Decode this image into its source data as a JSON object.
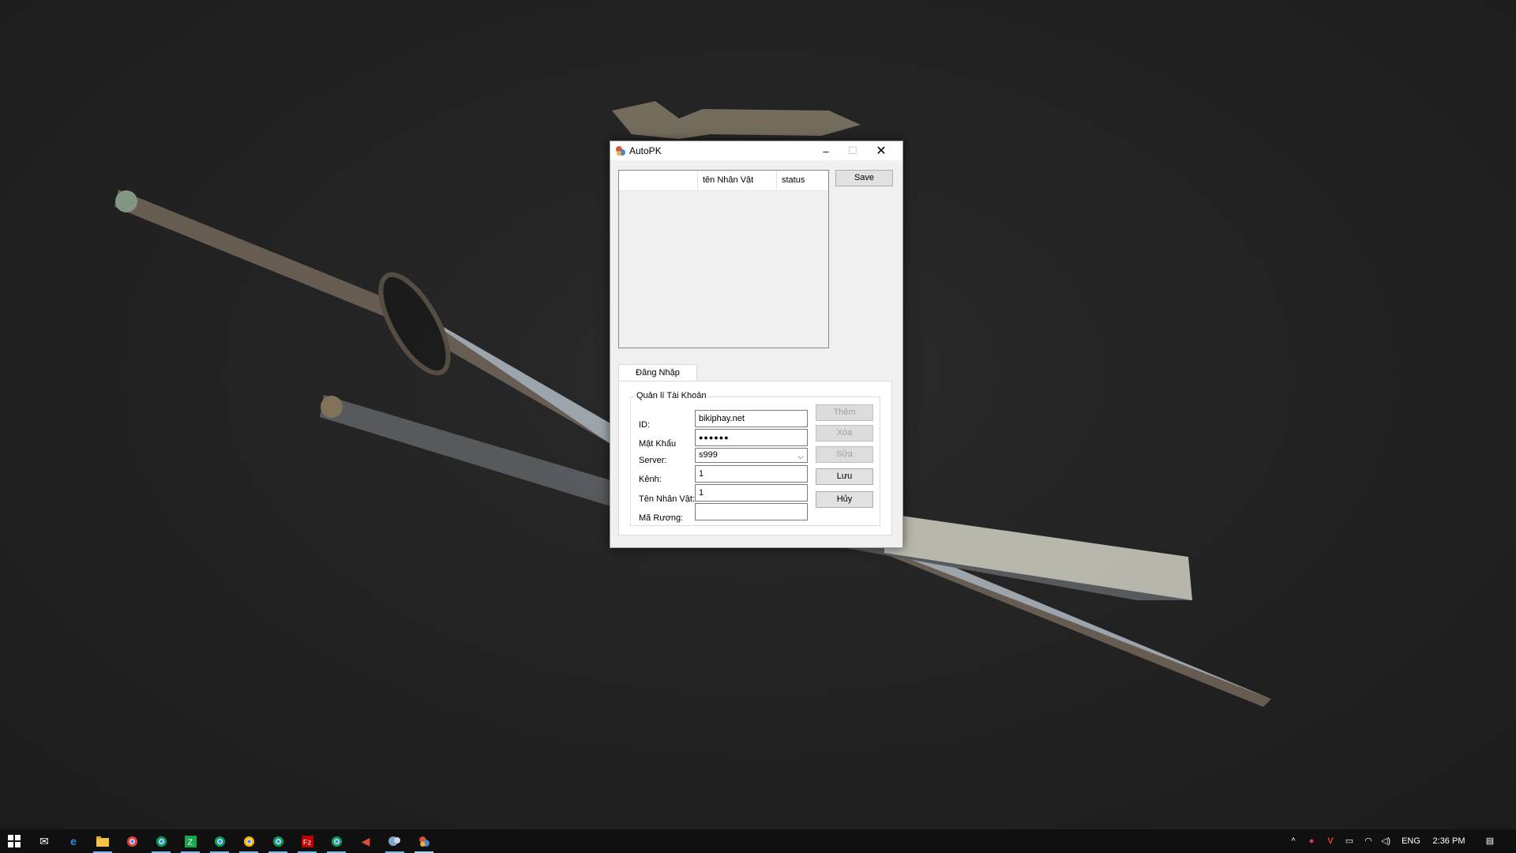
{
  "window": {
    "title": "AutoPK",
    "minimize_glyph": "–",
    "maximize_glyph": "☐",
    "close_glyph": "✕"
  },
  "listview": {
    "columns": [
      "",
      "tên Nhân Vật",
      "status"
    ]
  },
  "save_button": "Save",
  "tabs": [
    "Đăng Nhập"
  ],
  "group": {
    "title": "Quản lí Tài Khoản",
    "labels": {
      "id": "ID:",
      "password": "Mật Khẩu",
      "server": "Server:",
      "channel": "Kênh:",
      "character": "Tên Nhân Vật:",
      "chest_code": "Mã Rương:"
    },
    "values": {
      "id": "bikiphay.net",
      "password": "●●●●●●",
      "server": "s999",
      "channel": "1",
      "character": "1",
      "chest_code": ""
    },
    "buttons": {
      "add": "Thêm",
      "delete": "Xóa",
      "edit": "Sửa",
      "save": "Lưu",
      "cancel": "Hủy"
    }
  },
  "taskbar": {
    "pinned_icons": [
      "windows-start-icon",
      "mail-icon",
      "edge-icon",
      "file-explorer-icon",
      "chrome-icon",
      "chrome-icon",
      "zalo-icon",
      "chrome-icon",
      "chrome-icon",
      "chrome-icon",
      "filezilla-icon",
      "chrome-icon",
      "media-player-icon",
      "app-icon",
      "autopk-icon"
    ],
    "tray": {
      "language": "ENG",
      "time": "2:36 PM"
    }
  },
  "colors": {
    "accent": "#76b9ed",
    "desktop": "#1f1f1f",
    "taskbar": "#101010"
  }
}
